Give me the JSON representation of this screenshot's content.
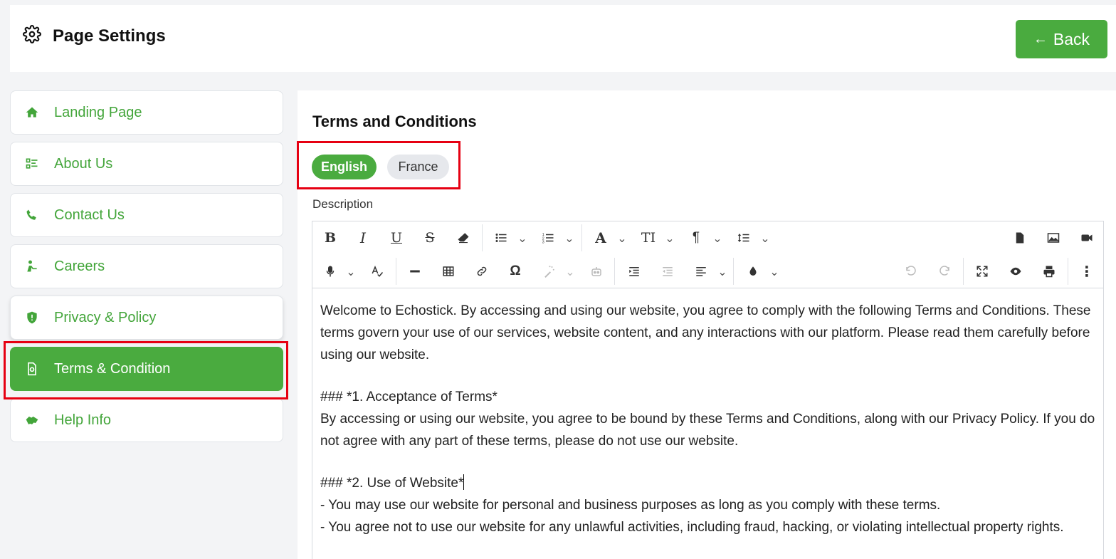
{
  "header": {
    "title": "Page Settings",
    "back_label": "Back"
  },
  "sidebar": {
    "items": [
      {
        "label": "Landing Page",
        "icon": "home-icon"
      },
      {
        "label": "About Us",
        "icon": "list-icon"
      },
      {
        "label": "Contact Us",
        "icon": "contact-icon"
      },
      {
        "label": "Careers",
        "icon": "careers-icon"
      },
      {
        "label": "Privacy & Policy",
        "icon": "shield-icon"
      },
      {
        "label": "Terms & Condition",
        "icon": "document-icon",
        "active": true
      },
      {
        "label": "Help Info",
        "icon": "handshake-icon"
      }
    ]
  },
  "main": {
    "title": "Terms and Conditions",
    "languages": [
      "English",
      "France"
    ],
    "selected_language": "English",
    "description_label": "Description",
    "content": {
      "p1": "Welcome to Echostick. By accessing and using our website, you agree to comply with the following Terms and Conditions. These terms govern your use of our services, website content, and any interactions with our platform. Please read them carefully before using our website.",
      "h1": "### *1. Acceptance of Terms*",
      "p2": "By accessing or using our website, you agree to be bound by these Terms and Conditions, along with our Privacy Policy. If you do not agree with any part of these terms, please do not use our website.",
      "h2": "### *2. Use of Website*",
      "l1": "- You may use our website for personal and business purposes as long as you comply with these terms.",
      "l2": "- You agree not to use our website for any unlawful activities, including fraud, hacking, or violating intellectual property rights."
    }
  },
  "colors": {
    "accent": "#4aab3f",
    "highlight": "#e60012"
  }
}
